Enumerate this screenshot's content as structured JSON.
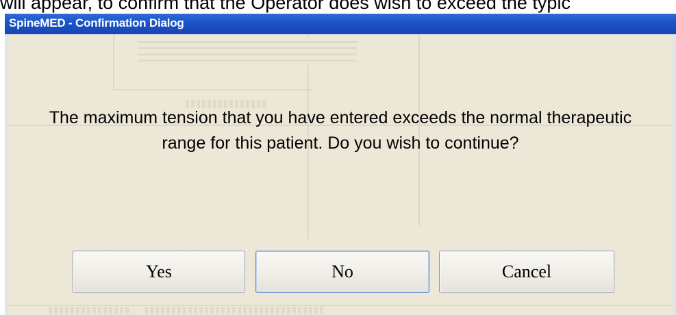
{
  "document": {
    "caption_fragment": "will appear, to confirm that the Operator does wish to exceed the typic"
  },
  "dialog": {
    "title": "SpineMED - Confirmation Dialog",
    "message": "The maximum tension that you have entered exceeds the normal therapeutic range for this patient.  Do you wish to continue?",
    "buttons": {
      "yes": "Yes",
      "no": "No",
      "cancel": "Cancel"
    },
    "default_button": "No"
  },
  "colors": {
    "titlebar": "#1c55c8",
    "title_text": "#ffffff",
    "client_background": "#ece7d7",
    "button_border": "#8796ad",
    "default_button_border": "#5a82c9"
  }
}
